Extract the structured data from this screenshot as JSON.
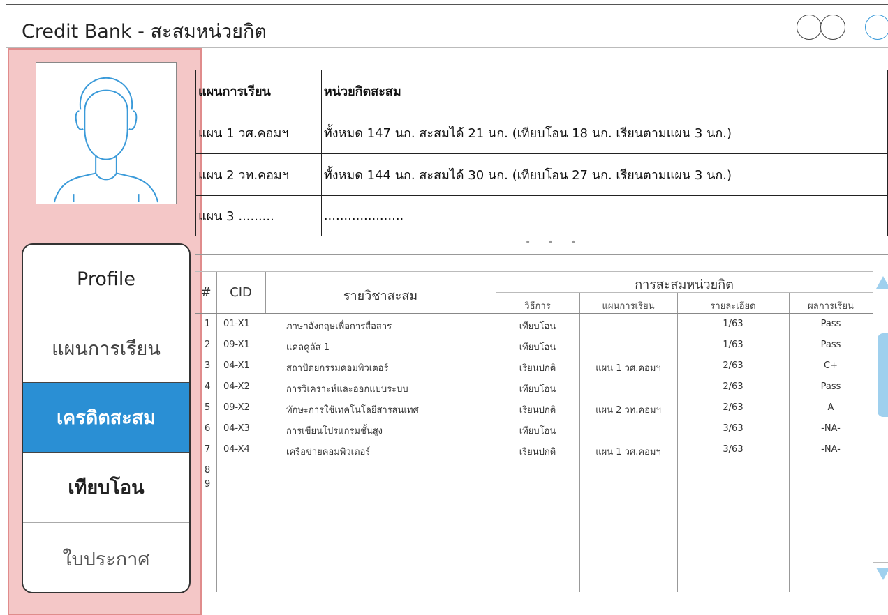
{
  "window": {
    "title": "Credit Bank - สะสมหน่วยกิต"
  },
  "sidebar": {
    "items": [
      {
        "label": "Profile"
      },
      {
        "label": "แผนการเรียน"
      },
      {
        "label": "เครดิตสะสม"
      },
      {
        "label": "เทียบโอน"
      },
      {
        "label": "ใบประกาศ"
      }
    ],
    "active": "เครดิตสะสม",
    "active_color": "#2a8fd4",
    "background_color": "#f4c7c7"
  },
  "summary": {
    "headers": [
      "แผนการเรียน",
      "หน่วยกิตสะสม"
    ],
    "rows": [
      [
        "แผน 1 วศ.คอมฯ",
        "ทั้งหมด 147 นก. สะสมได้ 21 นก. (เทียบโอน 18 นก. เรียนตามแผน 3 นก.)"
      ],
      [
        "แผน 2 วท.คอมฯ",
        "ทั้งหมด 144 นก. สะสมได้ 30 นก. (เทียบโอน 27 นก. เรียนตามแผน 3 นก.)"
      ],
      [
        "แผน 3 .........",
        "...................."
      ]
    ],
    "more_indicator": "• • •"
  },
  "details": {
    "headers": {
      "num": "#",
      "cid": "CID",
      "subject": "รายวิชาสะสม",
      "group": "การสะสมหน่วยกิต",
      "method": "วิธีการ",
      "plan": "แผนการเรียน",
      "detail": "รายละเอียด",
      "result": "ผลการเรียน"
    },
    "rows": [
      {
        "n": "1",
        "cid": "01-X1",
        "subject": "ภาษาอังกฤษเพื่อการสื่อสาร",
        "method": "เทียบโอน",
        "plan": "",
        "detail": "1/63",
        "result": "Pass"
      },
      {
        "n": "2",
        "cid": "09-X1",
        "subject": "แคลคูลัส 1",
        "method": "เทียบโอน",
        "plan": "",
        "detail": "1/63",
        "result": "Pass"
      },
      {
        "n": "3",
        "cid": "04-X1",
        "subject": "สถาปัตยกรรมคอมพิวเตอร์",
        "method": "เรียนปกติ",
        "plan": "แผน 1 วศ.คอมฯ",
        "detail": "2/63",
        "result": "C+"
      },
      {
        "n": "4",
        "cid": "04-X2",
        "subject": "การวิเคราะห์และออกแบบระบบ",
        "method": "เทียบโอน",
        "plan": "",
        "detail": "2/63",
        "result": "Pass"
      },
      {
        "n": "5",
        "cid": "09-X2",
        "subject": "ทักษะการใช้เทคโนโลยีสารสนเทศ",
        "method": "เรียนปกติ",
        "plan": "แผน 2 วท.คอมฯ",
        "detail": "2/63",
        "result": "A"
      },
      {
        "n": "6",
        "cid": "04-X3",
        "subject": "การเขียนโปรแกรมชั้นสูง",
        "method": "เทียบโอน",
        "plan": "",
        "detail": "3/63",
        "result": "-NA-"
      },
      {
        "n": "7",
        "cid": "04-X4",
        "subject": "เครือข่ายคอมพิวเตอร์",
        "method": "เรียนปกติ",
        "plan": "แผน 1 วศ.คอมฯ",
        "detail": "3/63",
        "result": "-NA-"
      },
      {
        "n": "8",
        "cid": "",
        "subject": "",
        "method": "",
        "plan": "",
        "detail": "",
        "result": ""
      },
      {
        "n": "9",
        "cid": "",
        "subject": "",
        "method": "",
        "plan": "",
        "detail": "",
        "result": ""
      }
    ]
  },
  "scrollbar": {
    "color": "#9fd0ee",
    "icons": [
      "scroll-up-icon",
      "scroll-down-icon"
    ]
  }
}
